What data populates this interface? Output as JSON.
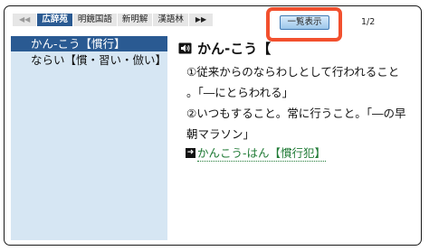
{
  "tabs": [
    {
      "label": "◀◀",
      "kind": "nav"
    },
    {
      "label": "広辞苑",
      "kind": "active"
    },
    {
      "label": "明鏡国語",
      "kind": "normal"
    },
    {
      "label": "新明解",
      "kind": "normal"
    },
    {
      "label": "漢語林",
      "kind": "normal"
    },
    {
      "label": "▶▶",
      "kind": "nav-next"
    }
  ],
  "list_button_label": "一覧表示",
  "page_indicator": "1/2",
  "sidebar": {
    "items": [
      {
        "label": "かん‐こう【慣行】",
        "selected": true
      },
      {
        "label": "ならい【慣・習い・倣い】",
        "selected": false
      }
    ]
  },
  "entry": {
    "speaker_icon": "speaker-icon",
    "headword": "かん‐こう【",
    "definition_lines": [
      "①従来からのならわしとして行われること",
      "。「―にとらわれる」",
      "②いつもすること。常に行うこと。「―の早",
      "朝マラソン」"
    ],
    "cross_reference": "かんこう‐はん【慣行犯】"
  },
  "colors": {
    "active_tab": "#2a5a92",
    "sidebar_bg": "#d6e6f3",
    "highlight_outline": "#f2502e",
    "link_green": "#1f7a35"
  }
}
